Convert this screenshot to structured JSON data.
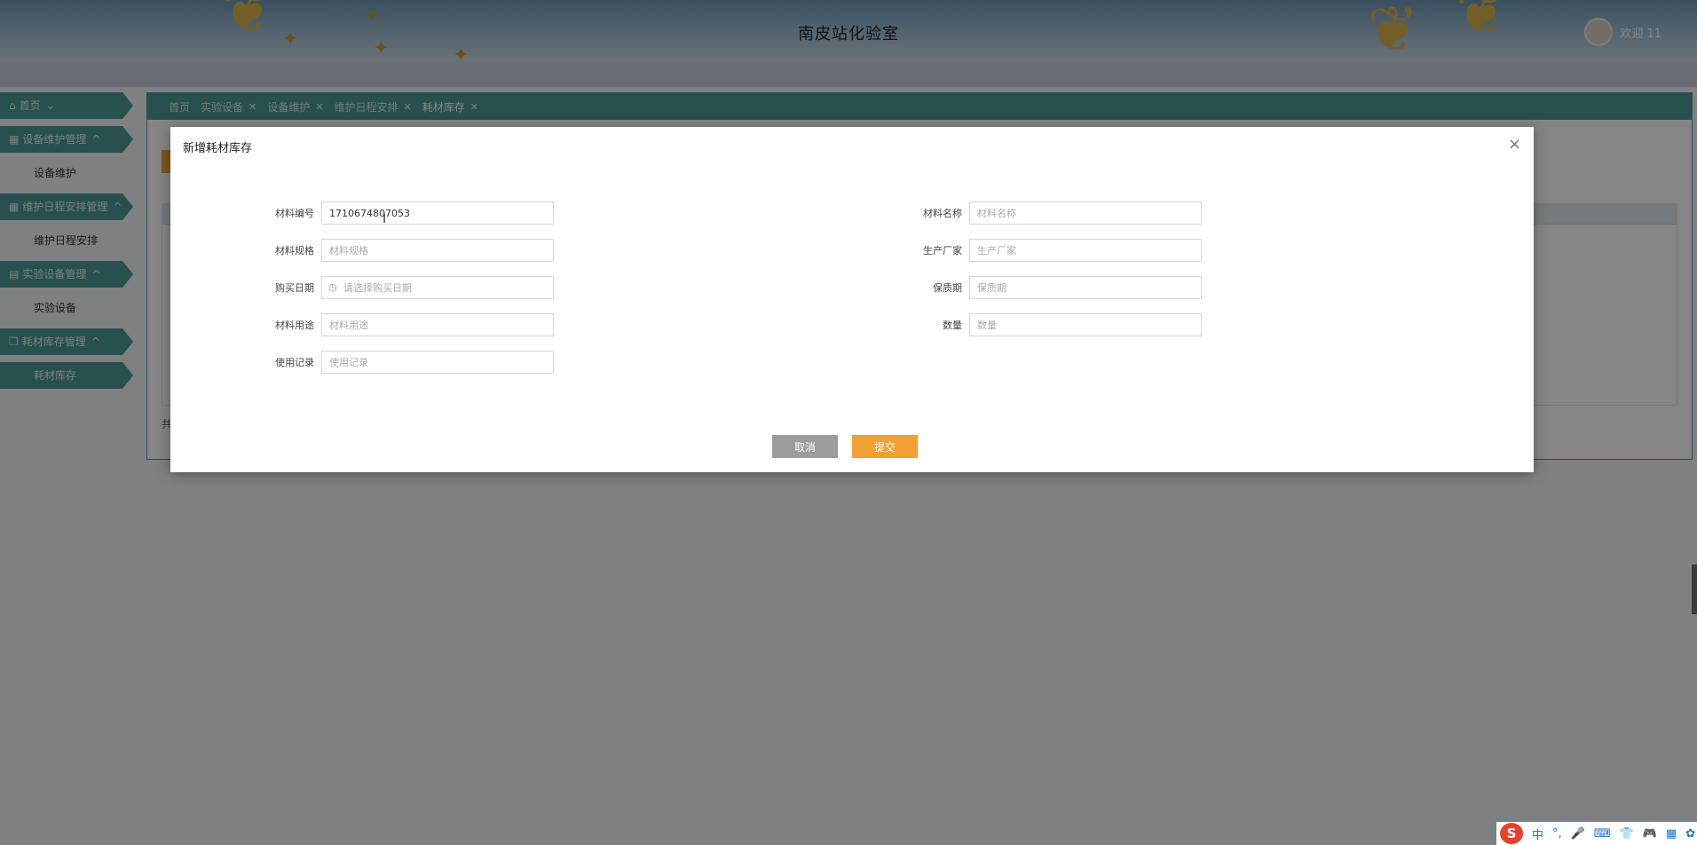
{
  "header": {
    "title": "南皮站化验室",
    "welcome": "欢迎 11"
  },
  "sidebar": {
    "items": [
      {
        "type": "group",
        "label": "首页",
        "icon": "home-icon",
        "arrow": "⌄"
      },
      {
        "type": "group",
        "label": "设备维护管理",
        "icon": "grid-icon",
        "arrow": "^"
      },
      {
        "type": "sub",
        "label": "设备维护"
      },
      {
        "type": "group",
        "label": "维护日程安排管理",
        "icon": "grid-icon",
        "arrow": "^"
      },
      {
        "type": "sub",
        "label": "维护日程安排"
      },
      {
        "type": "group",
        "label": "实验设备管理",
        "icon": "box-icon",
        "arrow": "^"
      },
      {
        "type": "sub",
        "label": "实验设备"
      },
      {
        "type": "group",
        "label": "耗材库存管理",
        "icon": "copy-icon",
        "arrow": "^"
      },
      {
        "type": "sub",
        "label": "耗材库存",
        "active": true
      }
    ]
  },
  "tabs": [
    {
      "label": "首页",
      "closable": false
    },
    {
      "label": "实验设备",
      "closable": true
    },
    {
      "label": "设备维护",
      "closable": true
    },
    {
      "label": "维护日程安排",
      "closable": true
    },
    {
      "label": "耗材库存",
      "closable": true,
      "active": true
    }
  ],
  "footer_hint": "共",
  "dialog": {
    "title": "新增耗材库存",
    "close": "×",
    "fields": {
      "code": {
        "label": "材料编号",
        "value": "1710674807053",
        "placeholder": ""
      },
      "name": {
        "label": "材料名称",
        "value": "",
        "placeholder": "材料名称"
      },
      "spec": {
        "label": "材料规格",
        "value": "",
        "placeholder": "材料规格"
      },
      "maker": {
        "label": "生产厂家",
        "value": "",
        "placeholder": "生产厂家"
      },
      "buy_date": {
        "label": "购买日期",
        "value": "",
        "placeholder": "请选择购买日期"
      },
      "shelf": {
        "label": "保质期",
        "value": "",
        "placeholder": "保质期"
      },
      "usage": {
        "label": "材料用途",
        "value": "",
        "placeholder": "材料用途"
      },
      "qty": {
        "label": "数量",
        "value": "",
        "placeholder": "数量"
      },
      "record": {
        "label": "使用记录",
        "value": "",
        "placeholder": "使用记录"
      }
    },
    "cancel_label": "取消",
    "submit_label": "提交"
  },
  "ime": {
    "logo": "S",
    "items": [
      "中",
      "°,",
      "🎤",
      "⌨",
      "👕",
      "🎮",
      "▦",
      "✿"
    ]
  },
  "colors": {
    "accent": "#4d9a98",
    "submit": "#f29f34",
    "cancel": "#9c9c9c"
  }
}
